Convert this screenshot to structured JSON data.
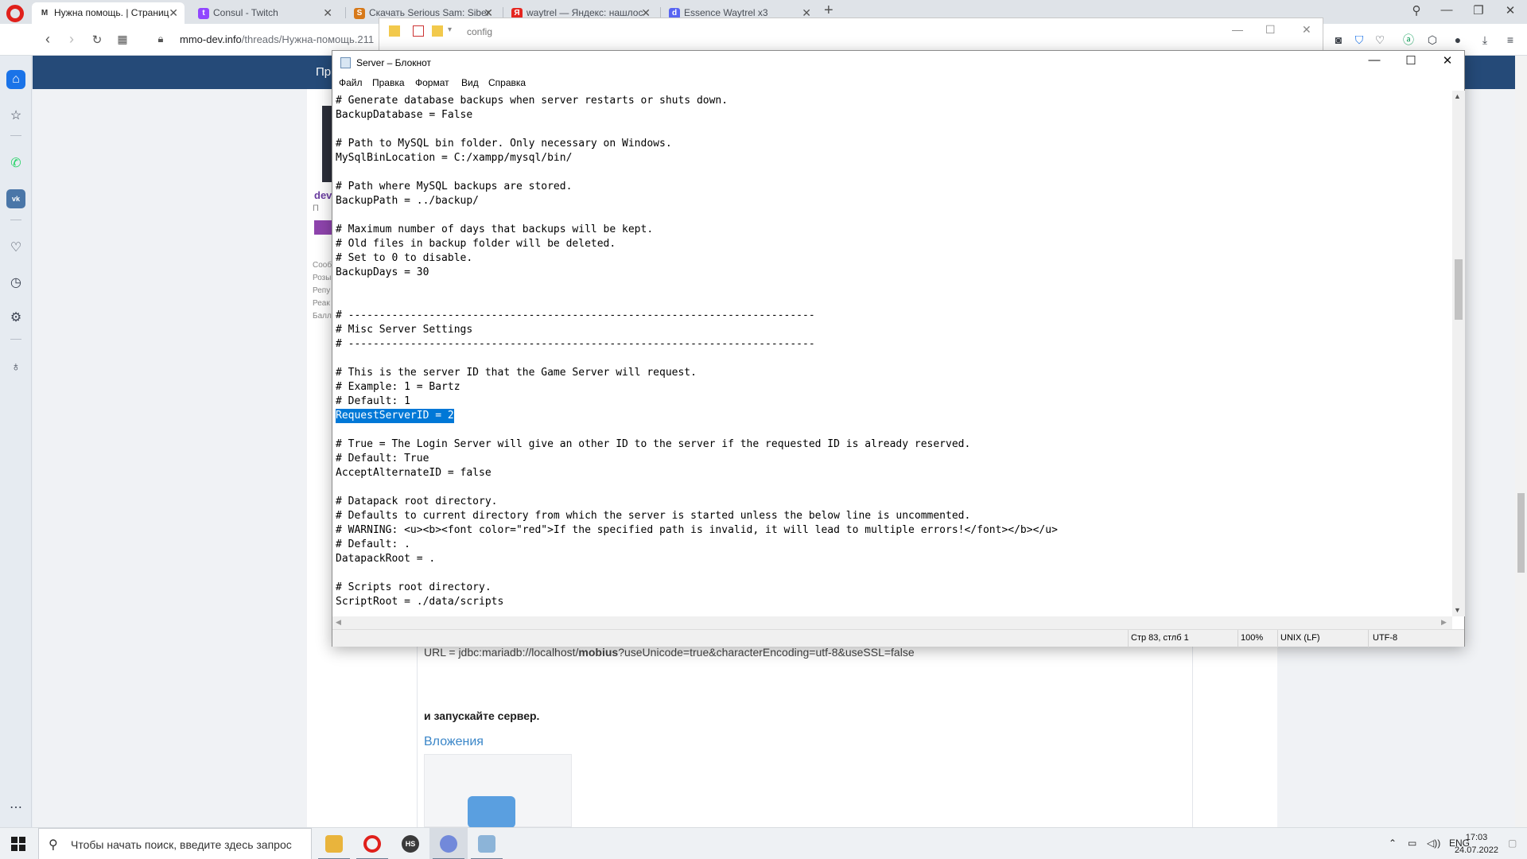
{
  "browser": {
    "tabs": [
      {
        "label": "Нужна помощь. | Страниц",
        "icon": "mmo-dev-icon",
        "active": true
      },
      {
        "label": "Consul - Twitch",
        "icon": "twitch-icon"
      },
      {
        "label": "Скачать Serious Sam: Siber",
        "icon": "game-icon"
      },
      {
        "label": "waytrel — Яндекс: нашлос",
        "icon": "yandex-icon"
      },
      {
        "label": "Essence Waytrel x3",
        "icon": "discord-icon"
      }
    ],
    "new_tab": "+",
    "url_host": "mmo-dev.info",
    "url_path": "/threads/Нужна-помощь.211"
  },
  "page": {
    "header_label": "Пр",
    "user_name": "dev",
    "user_sub": "П",
    "stats": [
      "Сооб",
      "Розы",
      "Репу",
      "Реак",
      "Балл"
    ],
    "post_url_line_pre": "URL = jdbc:mariadb://localhost/",
    "post_url_line_bold": "mobius",
    "post_url_line_post": "?useUnicode=true&characterEncoding=utf-8&useSSL=false",
    "post_text": "и запускайте сервер.",
    "attachments_title": "Вложения"
  },
  "explorer": {
    "title": "config"
  },
  "notepad": {
    "title": "Server – Блокнот",
    "menu": [
      "Файл",
      "Правка",
      "Формат",
      "Вид",
      "Справка"
    ],
    "lines": [
      "# Generate database backups when server restarts or shuts down.",
      "BackupDatabase = False",
      "",
      "# Path to MySQL bin folder. Only necessary on Windows.",
      "MySqlBinLocation = C:/xampp/mysql/bin/",
      "",
      "# Path where MySQL backups are stored.",
      "BackupPath = ../backup/",
      "",
      "# Maximum number of days that backups will be kept.",
      "# Old files in backup folder will be deleted.",
      "# Set to 0 to disable.",
      "BackupDays = 30",
      "",
      "",
      "# ---------------------------------------------------------------------------",
      "# Misc Server Settings",
      "# ---------------------------------------------------------------------------",
      "",
      "# This is the server ID that the Game Server will request.",
      "# Example: 1 = Bartz",
      "# Default: 1",
      "RequestServerID = 2",
      "",
      "# True = The Login Server will give an other ID to the server if the requested ID is already reserved.",
      "# Default: True",
      "AcceptAlternateID = false",
      "",
      "# Datapack root directory.",
      "# Defaults to current directory from which the server is started unless the below line is uncommented.",
      "# WARNING: <u><b><font color=\"red\">If the specified path is invalid, it will lead to multiple errors!</font></b></u>",
      "# Default: .",
      "DatapackRoot = .",
      "",
      "# Scripts root directory.",
      "ScriptRoot = ./data/scripts"
    ],
    "selected_line": 22,
    "status": {
      "position": "Стр 83, стлб 1",
      "zoom": "100%",
      "eol": "UNIX (LF)",
      "encoding": "UTF-8"
    }
  },
  "taskbar": {
    "search_placeholder": "Чтобы начать поиск, введите здесь запрос",
    "apps": [
      {
        "name": "file-explorer",
        "glyph": "",
        "color": "#e9b43c"
      },
      {
        "name": "opera",
        "glyph": "O",
        "color": "#e0201b"
      },
      {
        "name": "hs",
        "glyph": "HS",
        "color": "#3a3a3a"
      },
      {
        "name": "discord",
        "glyph": "",
        "color": "#7289da"
      },
      {
        "name": "notepad",
        "glyph": "",
        "color": "#8cb4d8"
      }
    ],
    "lang": "ENG",
    "time": "17:03",
    "date": "24.07.2022"
  }
}
